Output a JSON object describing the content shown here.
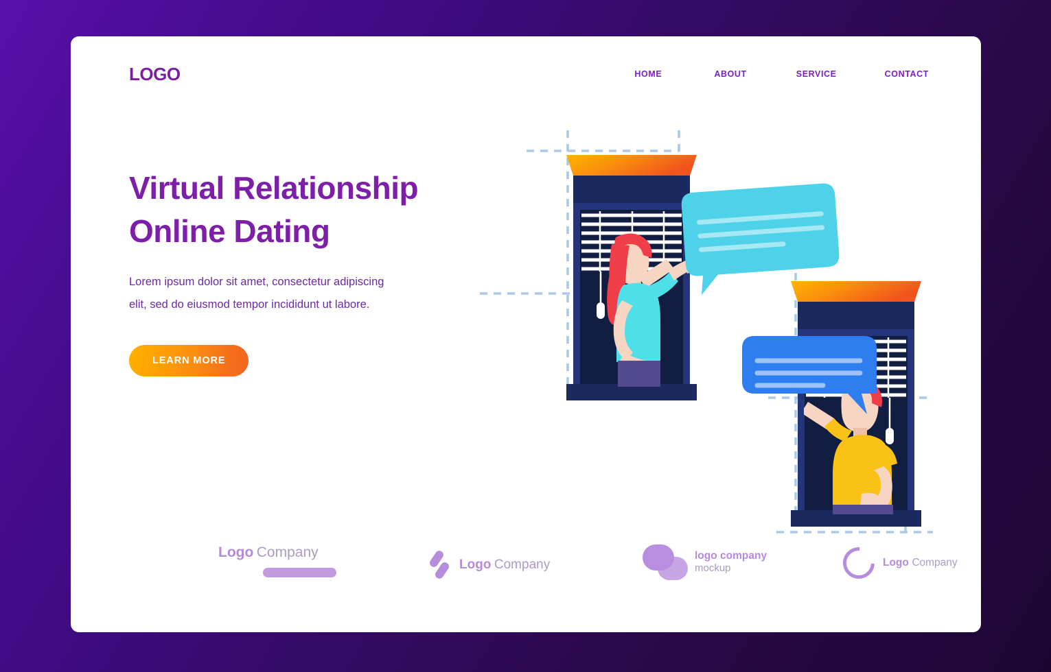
{
  "page": {
    "background_gradient_from": "#5a0fa8",
    "background_gradient_to": "#1c0630",
    "card_background": "#ffffff"
  },
  "header": {
    "logo_text": "LOGO",
    "logo_color": "#7a1fa2",
    "nav": [
      {
        "label": "HOME"
      },
      {
        "label": "ABOUT"
      },
      {
        "label": "SERVICE"
      },
      {
        "label": "CONTACT"
      }
    ],
    "nav_color": "#7c1ec4"
  },
  "hero": {
    "title": "Virtual Relationship\nOnline Dating",
    "title_color": "#7d1fa8",
    "subtitle": "Lorem ipsum dolor sit amet, consectetur adipiscing\nelit, sed do eiusmod tempor incididunt ut labore.",
    "subtitle_color": "#6b2a9e",
    "cta_label": "LEARN MORE",
    "cta_gradient_from": "#ffb000",
    "cta_gradient_to": "#f26520",
    "cta_text_color": "#ffffff"
  },
  "illustration": {
    "description": "Two people chatting from windows with speech bubbles",
    "window_frame_color": "#1b2a5e",
    "window_inner_color": "#131f45",
    "awning_gradient_from": "#ffb400",
    "awning_gradient_to": "#f0541b",
    "blind_color": "#ffffff",
    "guide_line_color": "#a9c9e8",
    "woman": {
      "hair_color": "#ef3e48",
      "shirt_color": "#4fdfe9",
      "skin_color": "#f6d6c3",
      "pants_color": "#534a8f",
      "bubble_color": "#4ed2ea",
      "bubble_line_color": "#a7e8f5",
      "bubble_lines": 3
    },
    "man": {
      "hair_color": "#ef3e48",
      "shirt_color": "#fac216",
      "skin_color": "#f6d6c3",
      "pants_color": "#534a8f",
      "bubble_color": "#2f7ef0",
      "bubble_line_color": "#9dc2f7",
      "bubble_lines": 3
    }
  },
  "footer": {
    "logos": [
      {
        "id": "logo-underline",
        "bold": "Logo",
        "light": "Company",
        "mark": "underline-bar"
      },
      {
        "id": "logo-diagonal",
        "bold": "Logo",
        "light": "Company",
        "mark": "diagonal-bars"
      },
      {
        "id": "logo-pills",
        "bold": "logo company",
        "light": "mockup",
        "mark": "overlapping-pills"
      },
      {
        "id": "logo-c-ring",
        "bold": "Logo",
        "light": "Company",
        "mark": "c-ring"
      }
    ],
    "accent_color": "#b68ddc",
    "text_color": "#ad9bc4"
  }
}
